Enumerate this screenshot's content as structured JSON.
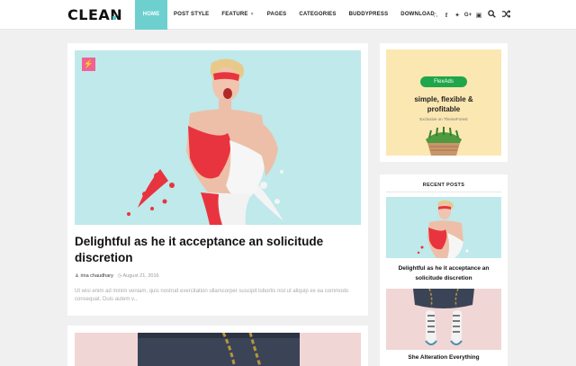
{
  "header": {
    "logo": "CLEAN",
    "nav": [
      {
        "label": "HOME",
        "active": true
      },
      {
        "label": "POST STYLE"
      },
      {
        "label": "FEATURE",
        "has_caret": true
      },
      {
        "label": "PAGES"
      },
      {
        "label": "CATEGORIES"
      },
      {
        "label": "BUDDYPRESS"
      },
      {
        "label": "DOWNLOAD"
      }
    ],
    "social_icons": [
      "rss-icon",
      "facebook-icon",
      "twitter-icon",
      "google-plus-icon",
      "instagram-icon"
    ],
    "tool_icons": [
      "search-icon",
      "shuffle-icon"
    ],
    "accent_color": "#6dd0cf"
  },
  "main_post": {
    "badge_icon": "lightning-icon",
    "title": "Delightful as he it acceptance an solicitude discretion",
    "author": "rina chaudhary",
    "date": "August 21, 2016",
    "excerpt": "Ut wisi enim ad minim veniam, quis nostrud exercitation ullamcorper suscipit lobortis nisl ut aliquip ex ea commodo consequat. Duis autem v..."
  },
  "ad": {
    "pill": "FlexAds",
    "line1": "simple, flexible &",
    "line2": "profitable",
    "small": "Exclusive on ThemeForest"
  },
  "recent_posts": {
    "heading": "RECENT POSTS",
    "items": [
      {
        "title": "Delightful as he it acceptance an solicitude discretion"
      },
      {
        "title": "She Alteration Everything"
      }
    ]
  }
}
